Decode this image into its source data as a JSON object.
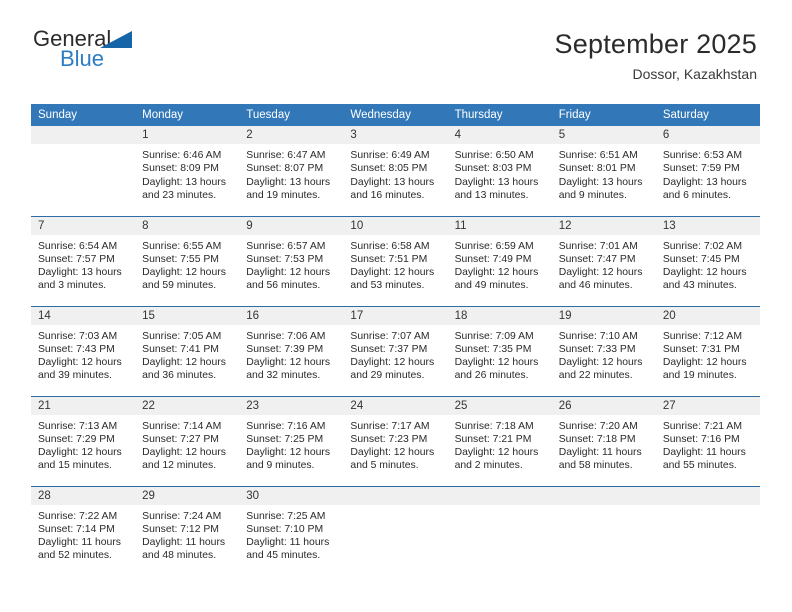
{
  "logo": {
    "text_top": "General",
    "text_bottom": "Blue",
    "triangle_color": "#1565a8",
    "blue_color": "#2d7dc4"
  },
  "header": {
    "title": "September 2025",
    "subtitle": "Dossor, Kazakhstan"
  },
  "theme": {
    "header_bg": "#3278b8",
    "daynum_bg": "#f0f0f0",
    "row_border": "#2e6da4"
  },
  "weekday_headers": [
    "Sunday",
    "Monday",
    "Tuesday",
    "Wednesday",
    "Thursday",
    "Friday",
    "Saturday"
  ],
  "weeks": [
    [
      {
        "day": "",
        "lines": []
      },
      {
        "day": "1",
        "lines": [
          "Sunrise: 6:46 AM",
          "Sunset: 8:09 PM",
          "Daylight: 13 hours",
          "and 23 minutes."
        ]
      },
      {
        "day": "2",
        "lines": [
          "Sunrise: 6:47 AM",
          "Sunset: 8:07 PM",
          "Daylight: 13 hours",
          "and 19 minutes."
        ]
      },
      {
        "day": "3",
        "lines": [
          "Sunrise: 6:49 AM",
          "Sunset: 8:05 PM",
          "Daylight: 13 hours",
          "and 16 minutes."
        ]
      },
      {
        "day": "4",
        "lines": [
          "Sunrise: 6:50 AM",
          "Sunset: 8:03 PM",
          "Daylight: 13 hours",
          "and 13 minutes."
        ]
      },
      {
        "day": "5",
        "lines": [
          "Sunrise: 6:51 AM",
          "Sunset: 8:01 PM",
          "Daylight: 13 hours",
          "and 9 minutes."
        ]
      },
      {
        "day": "6",
        "lines": [
          "Sunrise: 6:53 AM",
          "Sunset: 7:59 PM",
          "Daylight: 13 hours",
          "and 6 minutes."
        ]
      }
    ],
    [
      {
        "day": "7",
        "lines": [
          "Sunrise: 6:54 AM",
          "Sunset: 7:57 PM",
          "Daylight: 13 hours",
          "and 3 minutes."
        ]
      },
      {
        "day": "8",
        "lines": [
          "Sunrise: 6:55 AM",
          "Sunset: 7:55 PM",
          "Daylight: 12 hours",
          "and 59 minutes."
        ]
      },
      {
        "day": "9",
        "lines": [
          "Sunrise: 6:57 AM",
          "Sunset: 7:53 PM",
          "Daylight: 12 hours",
          "and 56 minutes."
        ]
      },
      {
        "day": "10",
        "lines": [
          "Sunrise: 6:58 AM",
          "Sunset: 7:51 PM",
          "Daylight: 12 hours",
          "and 53 minutes."
        ]
      },
      {
        "day": "11",
        "lines": [
          "Sunrise: 6:59 AM",
          "Sunset: 7:49 PM",
          "Daylight: 12 hours",
          "and 49 minutes."
        ]
      },
      {
        "day": "12",
        "lines": [
          "Sunrise: 7:01 AM",
          "Sunset: 7:47 PM",
          "Daylight: 12 hours",
          "and 46 minutes."
        ]
      },
      {
        "day": "13",
        "lines": [
          "Sunrise: 7:02 AM",
          "Sunset: 7:45 PM",
          "Daylight: 12 hours",
          "and 43 minutes."
        ]
      }
    ],
    [
      {
        "day": "14",
        "lines": [
          "Sunrise: 7:03 AM",
          "Sunset: 7:43 PM",
          "Daylight: 12 hours",
          "and 39 minutes."
        ]
      },
      {
        "day": "15",
        "lines": [
          "Sunrise: 7:05 AM",
          "Sunset: 7:41 PM",
          "Daylight: 12 hours",
          "and 36 minutes."
        ]
      },
      {
        "day": "16",
        "lines": [
          "Sunrise: 7:06 AM",
          "Sunset: 7:39 PM",
          "Daylight: 12 hours",
          "and 32 minutes."
        ]
      },
      {
        "day": "17",
        "lines": [
          "Sunrise: 7:07 AM",
          "Sunset: 7:37 PM",
          "Daylight: 12 hours",
          "and 29 minutes."
        ]
      },
      {
        "day": "18",
        "lines": [
          "Sunrise: 7:09 AM",
          "Sunset: 7:35 PM",
          "Daylight: 12 hours",
          "and 26 minutes."
        ]
      },
      {
        "day": "19",
        "lines": [
          "Sunrise: 7:10 AM",
          "Sunset: 7:33 PM",
          "Daylight: 12 hours",
          "and 22 minutes."
        ]
      },
      {
        "day": "20",
        "lines": [
          "Sunrise: 7:12 AM",
          "Sunset: 7:31 PM",
          "Daylight: 12 hours",
          "and 19 minutes."
        ]
      }
    ],
    [
      {
        "day": "21",
        "lines": [
          "Sunrise: 7:13 AM",
          "Sunset: 7:29 PM",
          "Daylight: 12 hours",
          "and 15 minutes."
        ]
      },
      {
        "day": "22",
        "lines": [
          "Sunrise: 7:14 AM",
          "Sunset: 7:27 PM",
          "Daylight: 12 hours",
          "and 12 minutes."
        ]
      },
      {
        "day": "23",
        "lines": [
          "Sunrise: 7:16 AM",
          "Sunset: 7:25 PM",
          "Daylight: 12 hours",
          "and 9 minutes."
        ]
      },
      {
        "day": "24",
        "lines": [
          "Sunrise: 7:17 AM",
          "Sunset: 7:23 PM",
          "Daylight: 12 hours",
          "and 5 minutes."
        ]
      },
      {
        "day": "25",
        "lines": [
          "Sunrise: 7:18 AM",
          "Sunset: 7:21 PM",
          "Daylight: 12 hours",
          "and 2 minutes."
        ]
      },
      {
        "day": "26",
        "lines": [
          "Sunrise: 7:20 AM",
          "Sunset: 7:18 PM",
          "Daylight: 11 hours",
          "and 58 minutes."
        ]
      },
      {
        "day": "27",
        "lines": [
          "Sunrise: 7:21 AM",
          "Sunset: 7:16 PM",
          "Daylight: 11 hours",
          "and 55 minutes."
        ]
      }
    ],
    [
      {
        "day": "28",
        "lines": [
          "Sunrise: 7:22 AM",
          "Sunset: 7:14 PM",
          "Daylight: 11 hours",
          "and 52 minutes."
        ]
      },
      {
        "day": "29",
        "lines": [
          "Sunrise: 7:24 AM",
          "Sunset: 7:12 PM",
          "Daylight: 11 hours",
          "and 48 minutes."
        ]
      },
      {
        "day": "30",
        "lines": [
          "Sunrise: 7:25 AM",
          "Sunset: 7:10 PM",
          "Daylight: 11 hours",
          "and 45 minutes."
        ]
      },
      {
        "day": "",
        "lines": []
      },
      {
        "day": "",
        "lines": []
      },
      {
        "day": "",
        "lines": []
      },
      {
        "day": "",
        "lines": []
      }
    ]
  ]
}
